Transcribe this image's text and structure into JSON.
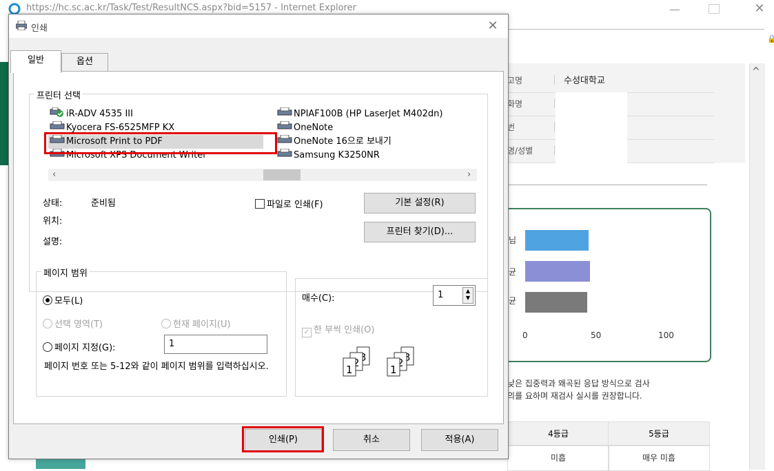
{
  "browser": {
    "title": "https://hc.sc.ac.kr/Task/Test/ResultNCS.aspx?bid=5157 - Internet Explorer",
    "info_rows": [
      {
        "key": "고명",
        "value": "수성대학교"
      },
      {
        "key": "화명",
        "value": ""
      },
      {
        "key": "번",
        "value": ""
      },
      {
        "key": "명/성별",
        "value": ""
      }
    ],
    "chart_labels": [
      "님",
      "균",
      "균"
    ],
    "chart_data": {
      "type": "bar",
      "categories": [
        "님",
        "균",
        "균"
      ],
      "values": [
        47,
        48,
        46
      ],
      "xticks": [
        "0",
        "50",
        "100"
      ],
      "xlim": [
        0,
        100
      ],
      "colors": [
        "#4fa3e0",
        "#8a8fd6",
        "#7a7a7a"
      ]
    },
    "notes": [
      "낮은 집중력과 왜곡된 응답 방식으로 검사",
      "의를 요하며 재검사 실시를 권장합니다."
    ],
    "table_headers": [
      "4등급",
      "5등급"
    ],
    "table_values": [
      "미흡",
      "매우 미흡"
    ]
  },
  "dialog": {
    "title": "인쇄",
    "tabs": [
      "일반",
      "옵션"
    ],
    "printer_group_label": "프린터 선택",
    "printers": [
      {
        "name": "iR-ADV 4535 III",
        "default": true
      },
      {
        "name": "Kyocera FS-6525MFP KX",
        "default": false
      },
      {
        "name": "Microsoft Print to PDF",
        "default": false,
        "selected": true
      },
      {
        "name": "Microsoft XPS Document Writer",
        "default": false
      },
      {
        "name": "NPIAF100B (HP LaserJet M402dn)",
        "default": false
      },
      {
        "name": "OneNote",
        "default": false
      },
      {
        "name": "OneNote 16으로 보내기",
        "default": false
      },
      {
        "name": "Samsung K3250NR",
        "default": false
      }
    ],
    "status_label": "상태:",
    "status_value": "준비됨",
    "location_label": "위치:",
    "comment_label": "설명:",
    "print_to_file": "파일로 인쇄(F)",
    "preferences_button": "기본 설정(R)",
    "find_printer_button": "프린터 찾기(D)...",
    "page_range_label": "페이지 범위",
    "range_all": "모두(L)",
    "range_selection": "선택 영역(T)",
    "range_current": "현재 페이지(U)",
    "range_pages": "페이지 지정(G):",
    "range_pages_value": "1",
    "range_hint": "페이지 번호 또는 5-12와 같이 페이지 범위를 입력하십시오.",
    "copies_label": "매수(C):",
    "copies_value": "1",
    "collate_label": "한 부씩 인쇄(O)",
    "print_button": "인쇄(P)",
    "cancel_button": "취소",
    "apply_button": "적용(A)",
    "accent": "#e00000"
  }
}
